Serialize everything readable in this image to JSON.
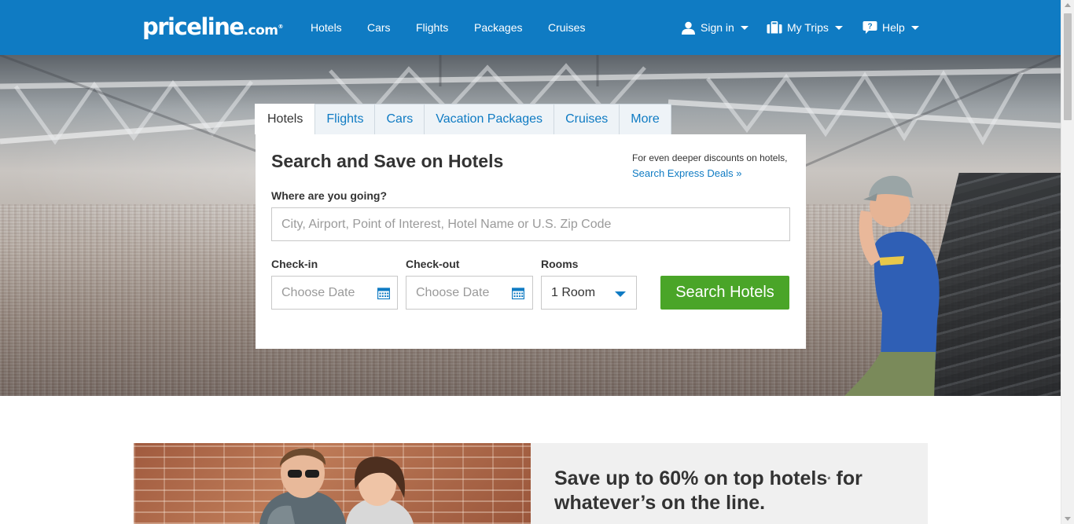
{
  "header": {
    "logo_main": "priceline",
    "logo_dotcom": ".com",
    "logo_reg": "®",
    "nav": [
      "Hotels",
      "Cars",
      "Flights",
      "Packages",
      "Cruises"
    ],
    "sign_in": "Sign in",
    "my_trips": "My Trips",
    "help": "Help"
  },
  "search": {
    "tabs": [
      "Hotels",
      "Flights",
      "Cars",
      "Vacation Packages",
      "Cruises",
      "More"
    ],
    "active_tab": "Hotels",
    "title": "Search and Save on Hotels",
    "deals_text": "For even deeper discounts on hotels,",
    "deals_link": "Search Express Deals »",
    "destination_label": "Where are you going?",
    "destination_placeholder": "City, Airport, Point of Interest, Hotel Name or U.S. Zip Code",
    "checkin_label": "Check-in",
    "checkin_placeholder": "Choose Date",
    "checkout_label": "Check-out",
    "checkout_placeholder": "Choose Date",
    "rooms_label": "Rooms",
    "rooms_value": "1 Room",
    "search_button": "Search Hotels"
  },
  "promo": {
    "headline_part1": "Save up to 60% on top hotels",
    "headline_sup": "*",
    "headline_part2": "for whatever’s on the line."
  },
  "colors": {
    "brand_blue": "#0f7bc3",
    "search_green": "#4aa528"
  },
  "icons": [
    "user-icon",
    "suitcase-icon",
    "help-bubble-icon",
    "calendar-icon",
    "chevron-down-icon"
  ]
}
